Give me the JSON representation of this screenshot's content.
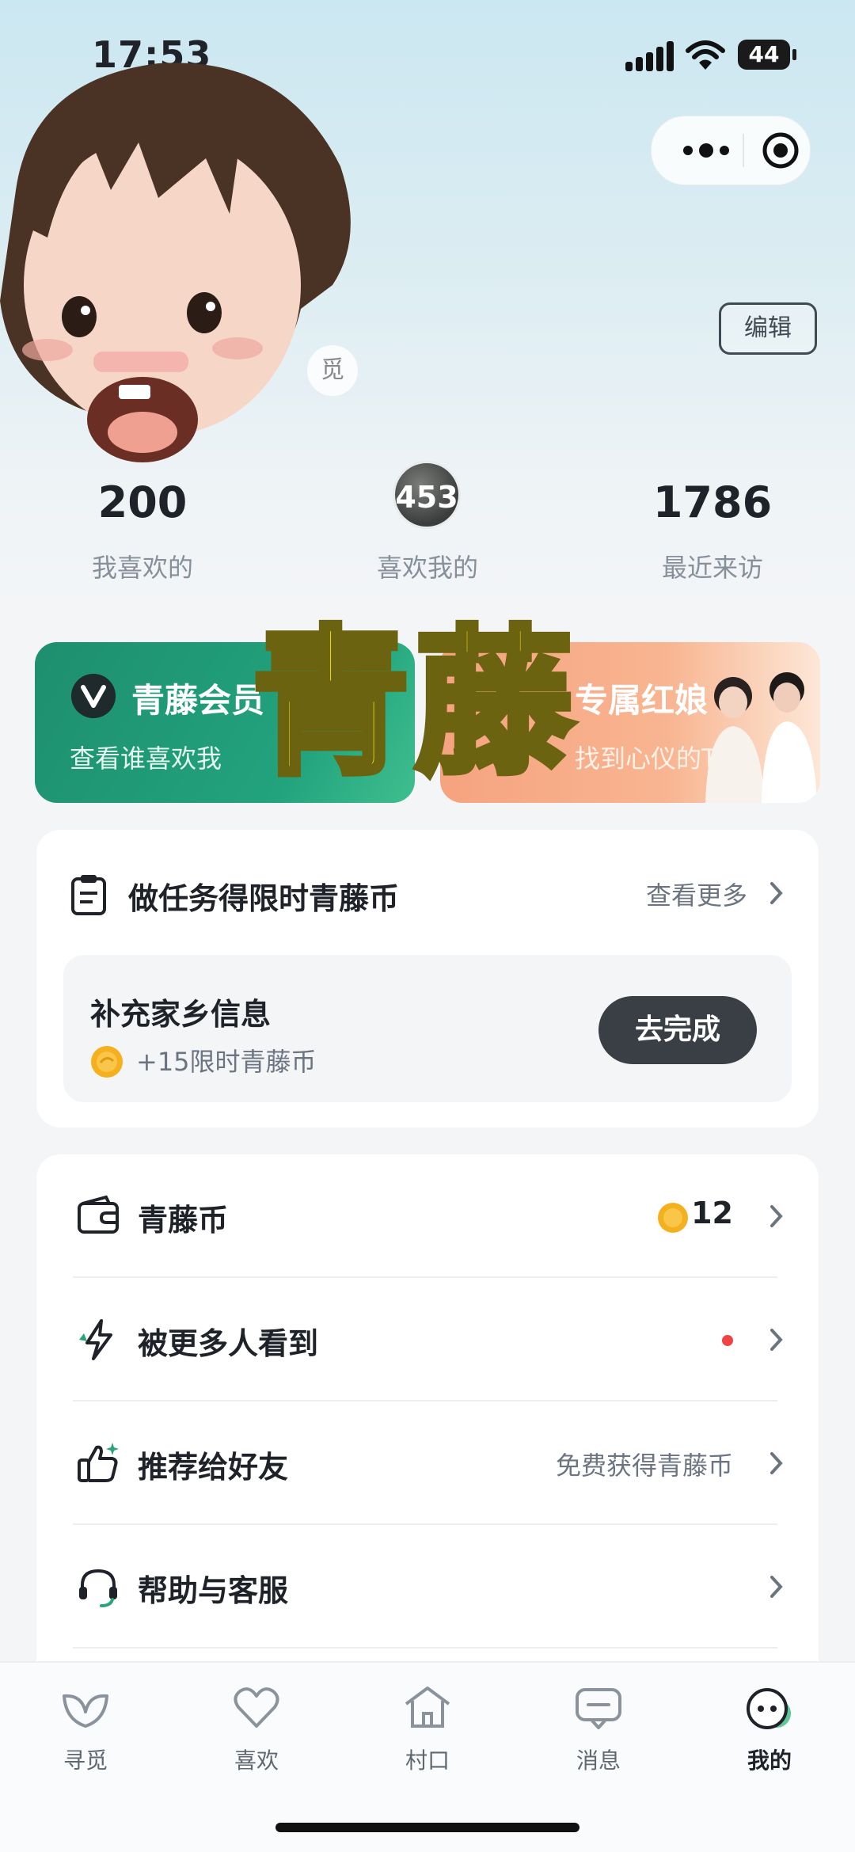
{
  "status_bar": {
    "time": "17:53",
    "battery": "44"
  },
  "profile": {
    "edit_label": "编辑",
    "hidden_text": "觅"
  },
  "stats": [
    {
      "value": "200",
      "label": "我喜欢的"
    },
    {
      "value": "453",
      "label": "喜欢我的"
    },
    {
      "value": "1786",
      "label": "最近来访"
    }
  ],
  "banners": {
    "left": {
      "title": "青藤会员",
      "subtitle": "查看谁喜欢我"
    },
    "right": {
      "title": "专属红娘",
      "subtitle": "找到心仪的TA"
    }
  },
  "overlay_text": "青藤",
  "tasks": {
    "title": "做任务得限时青藤币",
    "more": "查看更多",
    "item": {
      "title": "补充家乡信息",
      "reward": "+15限时青藤币",
      "action": "去完成"
    }
  },
  "menu": [
    {
      "label": "青藤币",
      "value": "12"
    },
    {
      "label": "被更多人看到"
    },
    {
      "label": "推荐给好友",
      "extra": "免费获得青藤币"
    },
    {
      "label": "帮助与客服"
    }
  ],
  "tabs": [
    {
      "label": "寻觅",
      "icon": "leaf-icon"
    },
    {
      "label": "喜欢",
      "icon": "heart-icon"
    },
    {
      "label": "村口",
      "icon": "home-icon"
    },
    {
      "label": "消息",
      "icon": "message-icon"
    },
    {
      "label": "我的",
      "icon": "profile-icon",
      "active": true
    }
  ],
  "colors": {
    "brand_green": "#1e8f6e",
    "accent_orange": "#f6a37f",
    "coin_gold": "#f5b01e",
    "red_dot": "#f04444"
  }
}
